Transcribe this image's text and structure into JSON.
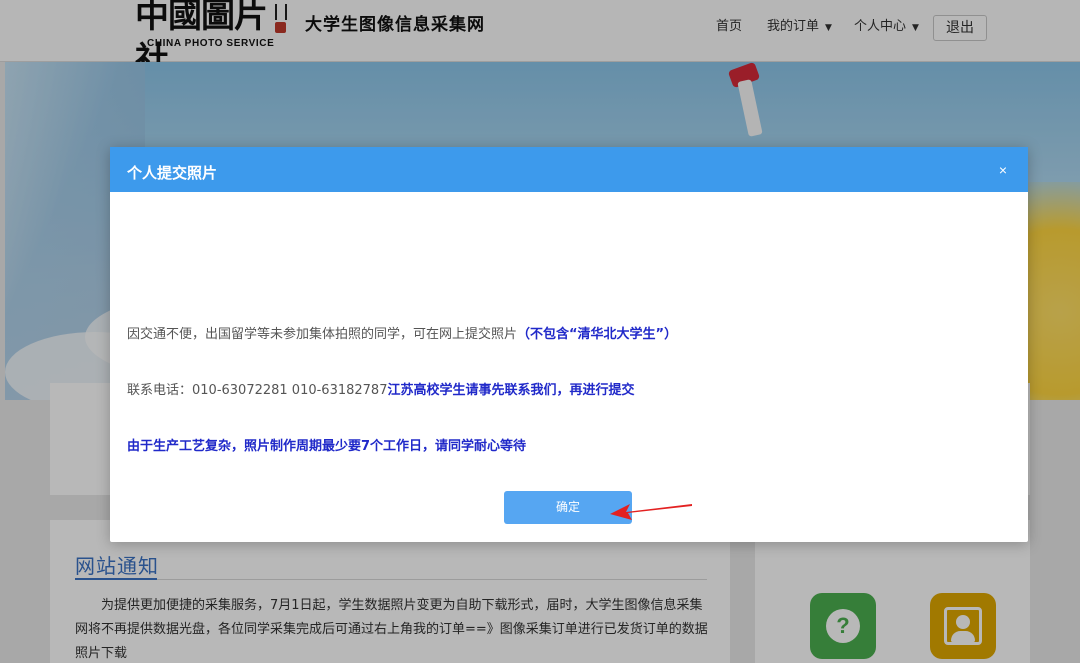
{
  "header": {
    "logo_cn": "中國圖片社",
    "logo_en": "CHINA PHOTO SERVICE",
    "site_subtitle": "大学生图像信息采集网",
    "nav": {
      "home": "首页",
      "my_orders": "我的订单",
      "personal_center": "个人中心",
      "logout": "退出"
    }
  },
  "notice": {
    "title": "网站通知",
    "body": "为提供更加便捷的采集服务，7月1日起，学生数据照片变更为自助下载形式，届时，大学生图像信息采集网将不再提供数据光盘，各位同学采集完成后可通过右上角我的订单==》图像采集订单进行已发货订单的数据照片下载"
  },
  "modal": {
    "title": "个人提交照片",
    "close_glyph": "×",
    "line1_text": "因交通不便，出国留学等未参加集体拍照的同学，可在网上提交照片",
    "line1_em": "（不包含“清华北大学生”）",
    "line2_text": "联系电话：010-63072281 010-63182787",
    "line2_em": "江苏高校学生请事先联系我们，再进行提交",
    "line3_em": "由于生产工艺复杂，照片制作周期最少要7个工作日，请同学耐心等待",
    "confirm_label": "确定"
  },
  "icons": {
    "help": "?"
  },
  "colors": {
    "modal_header": "#3d9aec",
    "confirm_button": "#56a6f2",
    "emphasis_text": "#2029c9",
    "notice_title": "#3b72c4",
    "help_icon_bg": "#4caf50",
    "photo_icon_bg": "#e0a800",
    "annotation_arrow": "#e32121"
  }
}
